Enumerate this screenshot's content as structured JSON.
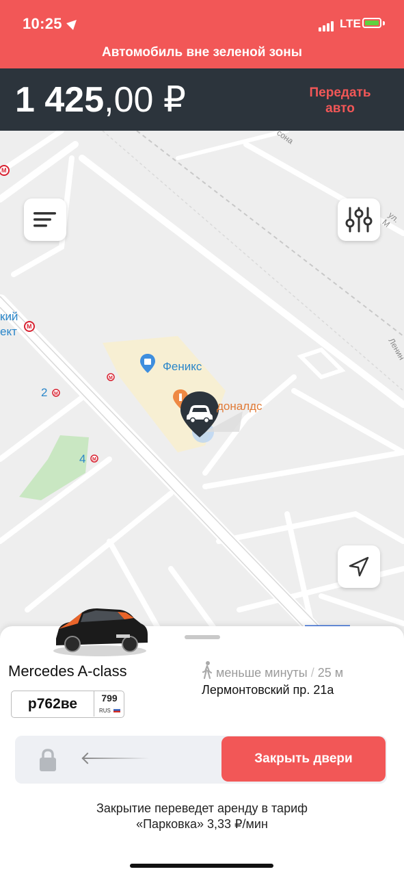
{
  "status_bar": {
    "time": "10:25",
    "network": "LTE"
  },
  "alert": "Автомобиль вне зеленой зоны",
  "price": {
    "integer": "1 425",
    "decimal": ",00 ₽"
  },
  "transfer_button": {
    "line1": "Передать",
    "line2": "авто"
  },
  "map": {
    "labels": {
      "feniks": "Феникс",
      "mcdonalds": "доналдс",
      "metro_station_left": "кий",
      "metro_station_left2": "ект",
      "exit_2": "2",
      "exit_4": "4",
      "street_top": "сона",
      "street_right": "ул. М",
      "street_lenin": "Ленин"
    }
  },
  "car": {
    "name": "Mercedes A-class",
    "plate_number": "р762ве",
    "plate_region": "799",
    "plate_country": "RUS",
    "walk_time": "меньше минуты",
    "distance": "25 м",
    "address": "Лермонтовский пр. 21а"
  },
  "actions": {
    "close_doors": "Закрыть двери"
  },
  "note": {
    "line1": "Закрытие переведет аренду в тариф",
    "line2": "«Парковка» 3,33 ₽/мин"
  },
  "colors": {
    "accent": "#f25757",
    "dark": "#2c343c",
    "map_bg": "#eeeeee",
    "link_blue": "#2a86c9"
  }
}
